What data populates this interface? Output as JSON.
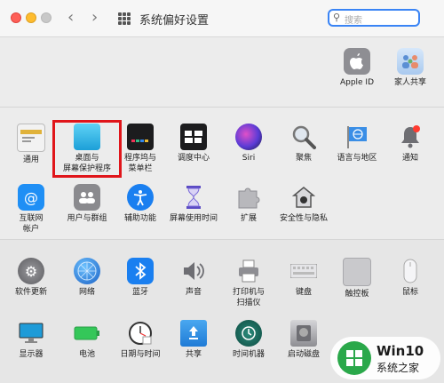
{
  "window": {
    "title": "系统偏好设置"
  },
  "search": {
    "placeholder": "搜索"
  },
  "section_top": [
    {
      "label": "Apple ID",
      "icon": "apple-icon"
    },
    {
      "label": "家人共享",
      "icon": "family-icon"
    }
  ],
  "section_personal": [
    {
      "label": "通用",
      "icon": "general-icon"
    },
    {
      "label": "桌面与\n屏幕保护程序",
      "icon": "desktop-icon"
    },
    {
      "label": "程序坞与\n菜单栏",
      "icon": "dock-icon"
    },
    {
      "label": "调度中心",
      "icon": "mission-control-icon"
    },
    {
      "label": "Siri",
      "icon": "siri-icon"
    },
    {
      "label": "聚焦",
      "icon": "spotlight-icon"
    },
    {
      "label": "语言与地区",
      "icon": "language-icon"
    },
    {
      "label": "通知",
      "icon": "notification-icon"
    },
    {
      "label": "互联网\n帐户",
      "icon": "internet-accounts-icon"
    },
    {
      "label": "用户与群组",
      "icon": "users-icon"
    },
    {
      "label": "辅助功能",
      "icon": "accessibility-icon"
    },
    {
      "label": "屏幕使用时间",
      "icon": "screen-time-icon"
    },
    {
      "label": "扩展",
      "icon": "extensions-icon"
    },
    {
      "label": "安全性与隐私",
      "icon": "security-icon"
    }
  ],
  "section_hardware": [
    {
      "label": "软件更新",
      "icon": "software-update-icon"
    },
    {
      "label": "网络",
      "icon": "network-icon"
    },
    {
      "label": "蓝牙",
      "icon": "bluetooth-icon"
    },
    {
      "label": "声音",
      "icon": "sound-icon"
    },
    {
      "label": "打印机与\n扫描仪",
      "icon": "printer-icon"
    },
    {
      "label": "键盘",
      "icon": "keyboard-icon"
    },
    {
      "label": "触控板",
      "icon": "trackpad-icon"
    },
    {
      "label": "鼠标",
      "icon": "mouse-icon"
    },
    {
      "label": "显示器",
      "icon": "display-icon"
    },
    {
      "label": "电池",
      "icon": "battery-icon"
    },
    {
      "label": "日期与时间",
      "icon": "clock-icon"
    },
    {
      "label": "共享",
      "icon": "sharing-icon"
    },
    {
      "label": "时间机器",
      "icon": "time-machine-icon"
    },
    {
      "label": "启动磁盘",
      "icon": "startup-disk-icon"
    }
  ],
  "watermark": {
    "line1": "Win10",
    "line2": "系统之家"
  }
}
